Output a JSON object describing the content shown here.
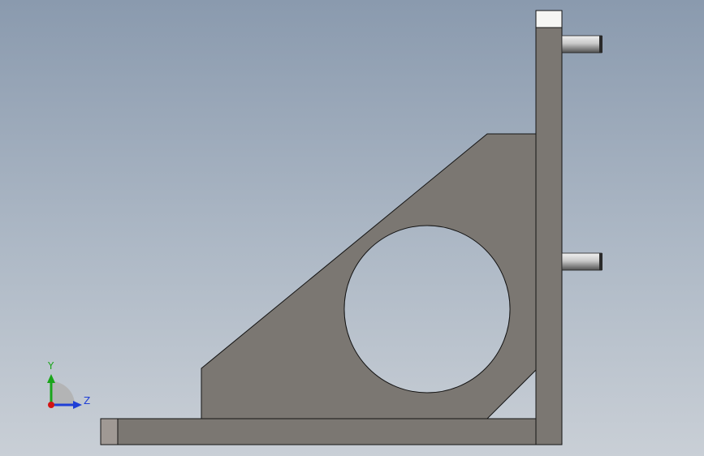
{
  "viewport": {
    "background_top": "#8a9aae",
    "background_bottom": "#c9cfd6"
  },
  "model": {
    "part_color": "#7b7772",
    "end_face_color": "#a09994",
    "top_face_color": "#f6f6f4",
    "edge_color": "#141414",
    "pin_color_light": "#e4e4e4",
    "pin_color_dark": "#565656"
  },
  "triad": {
    "y_label": "Y",
    "z_label": "Z",
    "y_color": "#1aa51a",
    "z_color": "#1f3fd6",
    "x_color": "#d21414"
  }
}
